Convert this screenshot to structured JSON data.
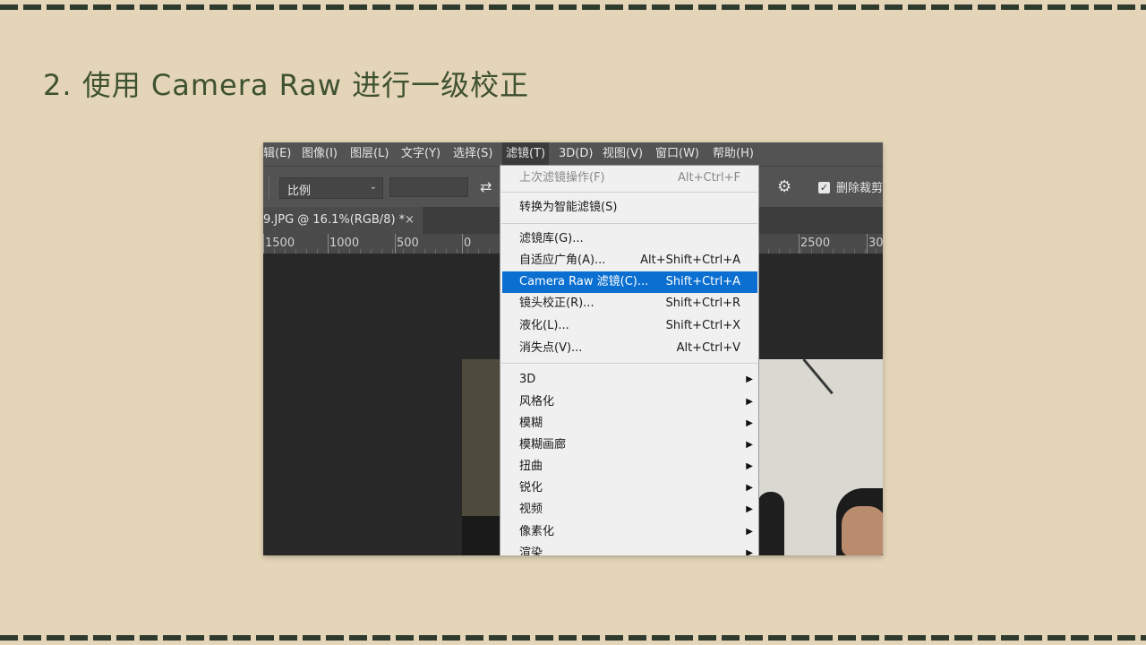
{
  "slide": {
    "title": "2. 使用 Camera Raw 进行一级校正"
  },
  "menubar": {
    "items": [
      "辑(E)",
      "图像(I)",
      "图层(L)",
      "文字(Y)",
      "选择(S)",
      "滤镜(T)",
      "3D(D)",
      "视图(V)",
      "窗口(W)",
      "帮助(H)"
    ]
  },
  "options_bar": {
    "ratio_value": "比例",
    "delete_cropped_label": "删除裁剪"
  },
  "document_tab": {
    "name": "9.JPG @ 16.1%(RGB/8) *"
  },
  "ruler": {
    "ticks": [
      "1500",
      "1000",
      "500",
      "0",
      "2500",
      "30"
    ]
  },
  "filter_menu": {
    "last_filter": {
      "label": "上次滤镜操作(F)",
      "shortcut": "Alt+Ctrl+F"
    },
    "convert_smart": {
      "label": "转换为智能滤镜(S)"
    },
    "filter_gallery": {
      "label": "滤镜库(G)..."
    },
    "adaptive_wide": {
      "label": "自适应广角(A)...",
      "shortcut": "Alt+Shift+Ctrl+A"
    },
    "camera_raw": {
      "label": "Camera Raw 滤镜(C)...",
      "shortcut": "Shift+Ctrl+A"
    },
    "lens_correction": {
      "label": "镜头校正(R)...",
      "shortcut": "Shift+Ctrl+R"
    },
    "liquify": {
      "label": "液化(L)...",
      "shortcut": "Shift+Ctrl+X"
    },
    "vanishing_point": {
      "label": "消失点(V)...",
      "shortcut": "Alt+Ctrl+V"
    },
    "submenus": [
      "3D",
      "风格化",
      "模糊",
      "模糊画廊",
      "扭曲",
      "锐化",
      "视频",
      "像素化",
      "渲染"
    ]
  },
  "colors": {
    "slide_background": "#e5d5b8",
    "title_color": "#3e5231",
    "menu_highlight": "#0a6fd1",
    "app_chrome": "#535353"
  }
}
